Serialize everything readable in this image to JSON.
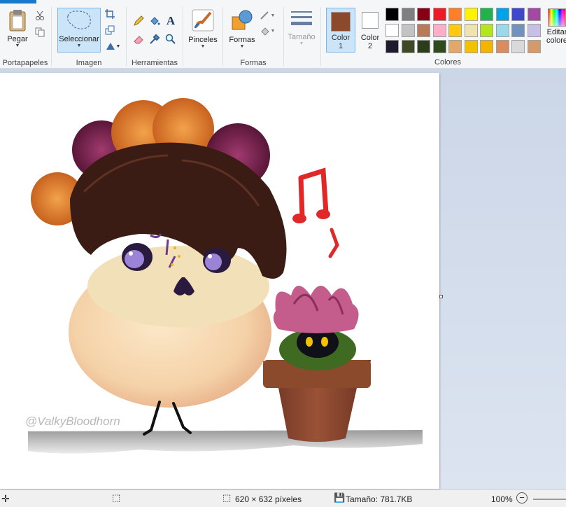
{
  "ribbon": {
    "clipboard": {
      "paste_label": "Pegar",
      "group_label": "Portapapeles"
    },
    "image": {
      "select_label": "Seleccionar",
      "group_label": "Imagen"
    },
    "tools": {
      "group_label": "Herramientas"
    },
    "brushes": {
      "label": "Pinceles"
    },
    "shapes": {
      "label": "Formas",
      "group_label": "Formas"
    },
    "size": {
      "label": "Tamaño"
    },
    "color1": {
      "label_line1": "Color",
      "label_line2": "1",
      "value": "#8b4a2b"
    },
    "color2": {
      "label_line1": "Color",
      "label_line2": "2",
      "value": "#ffffff"
    },
    "colors": {
      "group_label": "Colores"
    },
    "edit_colors": {
      "label_line1": "Editar",
      "label_line2": "colore"
    },
    "palette": [
      [
        "#000000",
        "#7f7f7f",
        "#880015",
        "#ed1c24",
        "#ff7f27",
        "#fff200",
        "#22b14c",
        "#00a2e8",
        "#3f48cc",
        "#a349a4"
      ],
      [
        "#ffffff",
        "#c3c3c3",
        "#b97a57",
        "#ffaec9",
        "#ffc90e",
        "#efe4b0",
        "#b5e61d",
        "#99d9ea",
        "#7092be",
        "#c8bfe7"
      ],
      [
        "#1f1a2e",
        "#3e4a23",
        "#2b3d1a",
        "#2f4a1c",
        "#e2a86a",
        "#f2c200",
        "#f5b400",
        "#d98c5f",
        "#d9d9d9",
        "#d49a6a"
      ]
    ]
  },
  "canvas": {
    "watermark": "@ValkyBloodhorn"
  },
  "status": {
    "dimensions": "620 × 632 píxeles",
    "size": "Tamaño: 781.7KB",
    "zoom": "100%"
  }
}
